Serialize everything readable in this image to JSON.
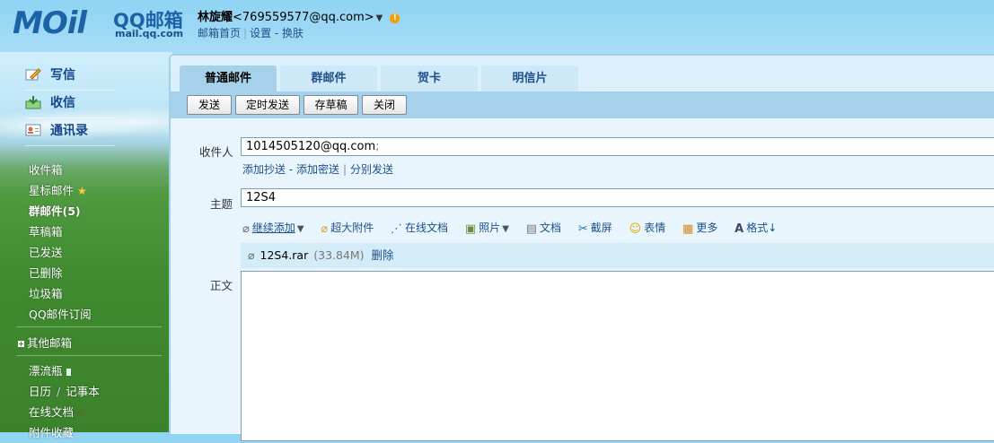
{
  "header": {
    "logo_word": "MOil",
    "logo_cn": "QQ邮箱",
    "logo_domain": "mail.qq.com",
    "user_name": "林旋耀",
    "user_email": "<769559577@qq.com>",
    "links": [
      "邮箱首页",
      "设置",
      "换肤"
    ]
  },
  "sidebar": {
    "main": [
      {
        "label": "写信",
        "icon": "write-icon"
      },
      {
        "label": "收信",
        "icon": "inbox-icon"
      },
      {
        "label": "通讯录",
        "icon": "contacts-icon"
      }
    ],
    "folders": [
      "收件箱",
      "星标邮件",
      "群邮件(5)",
      "草稿箱",
      "已发送",
      "已删除",
      "垃圾箱",
      "QQ邮件订阅"
    ],
    "other_mail": "其他邮箱",
    "apps": [
      "漂流瓶",
      "日历",
      "记事本",
      "在线文档",
      "附件收藏"
    ]
  },
  "tabs": [
    "普通邮件",
    "群邮件",
    "贺卡",
    "明信片"
  ],
  "toolbar": {
    "send": "发送",
    "schedule": "定时发送",
    "draft": "存草稿",
    "close": "关闭"
  },
  "compose": {
    "to_label": "收件人",
    "to_value": "1014505120@qq.com",
    "to_sep": ";",
    "cc_links": [
      "添加抄送",
      "添加密送",
      "分别发送"
    ],
    "subject_label": "主题",
    "subject_value": "12S4",
    "attach_tools": [
      "继续添加",
      "超大附件",
      "在线文档",
      "照片",
      "文档",
      "截屏",
      "表情",
      "更多",
      "格式↓"
    ],
    "attachment": {
      "name": "12S4.rar",
      "size": "(33.84M)",
      "delete": "删除"
    },
    "body_label": "正文"
  },
  "colors": {
    "accent": "#1f4f8a",
    "tab_active": "#a5d2ea",
    "form_bg": "#e8f5fc"
  }
}
